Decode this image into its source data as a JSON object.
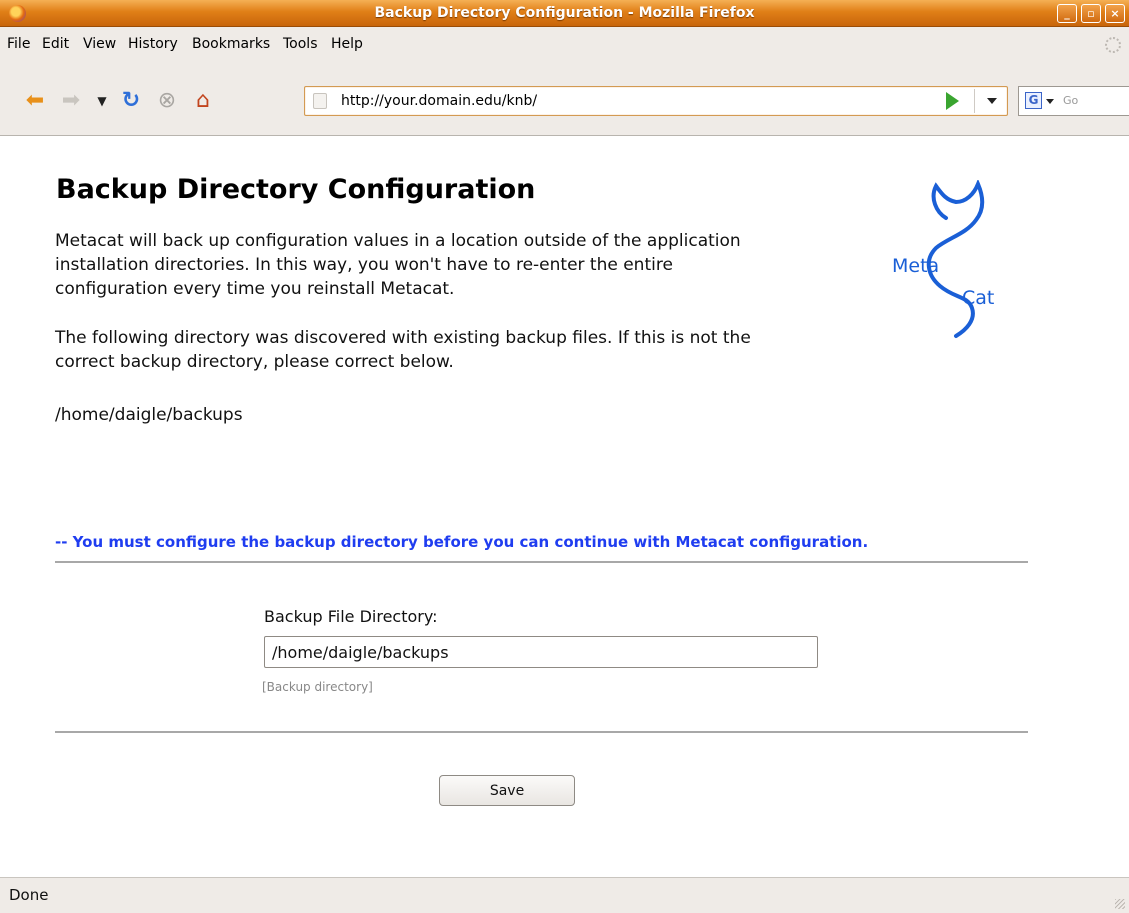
{
  "window": {
    "title": "Backup Directory Configuration - Mozilla Firefox",
    "controls": [
      "minimize",
      "maximize",
      "close"
    ]
  },
  "menu": {
    "items": [
      "File",
      "Edit",
      "View",
      "History",
      "Bookmarks",
      "Tools",
      "Help"
    ]
  },
  "toolbar": {
    "url": "http://your.domain.edu/knb/",
    "search_placeholder": "Go",
    "search_engine": "G",
    "icons": [
      "back-icon",
      "forward-icon",
      "history-dropdown-icon",
      "reload-icon",
      "stop-icon",
      "home-icon"
    ]
  },
  "page": {
    "title": "Backup Directory Configuration",
    "intro_line1": "Metacat will back up configuration values in a location outside of the application",
    "intro_line2": "installation directories. In this way, you won't have to re-enter the entire",
    "intro_line3": "configuration every time you reinstall Metacat.",
    "discovered_line1": "The following directory was discovered with existing backup files. If this is not the",
    "discovered_line2": "correct backup directory, please correct below.",
    "discovered_path": "/home/daigle/backups",
    "logo_text_top": "Meta",
    "logo_text_bottom": "Cat",
    "notice": "-- You must configure the backup directory before you can continue with Metacat configuration.",
    "field_label": "Backup File Directory:",
    "field_value": "/home/daigle/backups",
    "field_hint": "[Backup directory]",
    "save_label": "Save"
  },
  "status": {
    "text": "Done"
  },
  "colors": {
    "notice": "#1f3df0",
    "logo": "#1a5fd6",
    "titlebar": "#e07f17"
  }
}
